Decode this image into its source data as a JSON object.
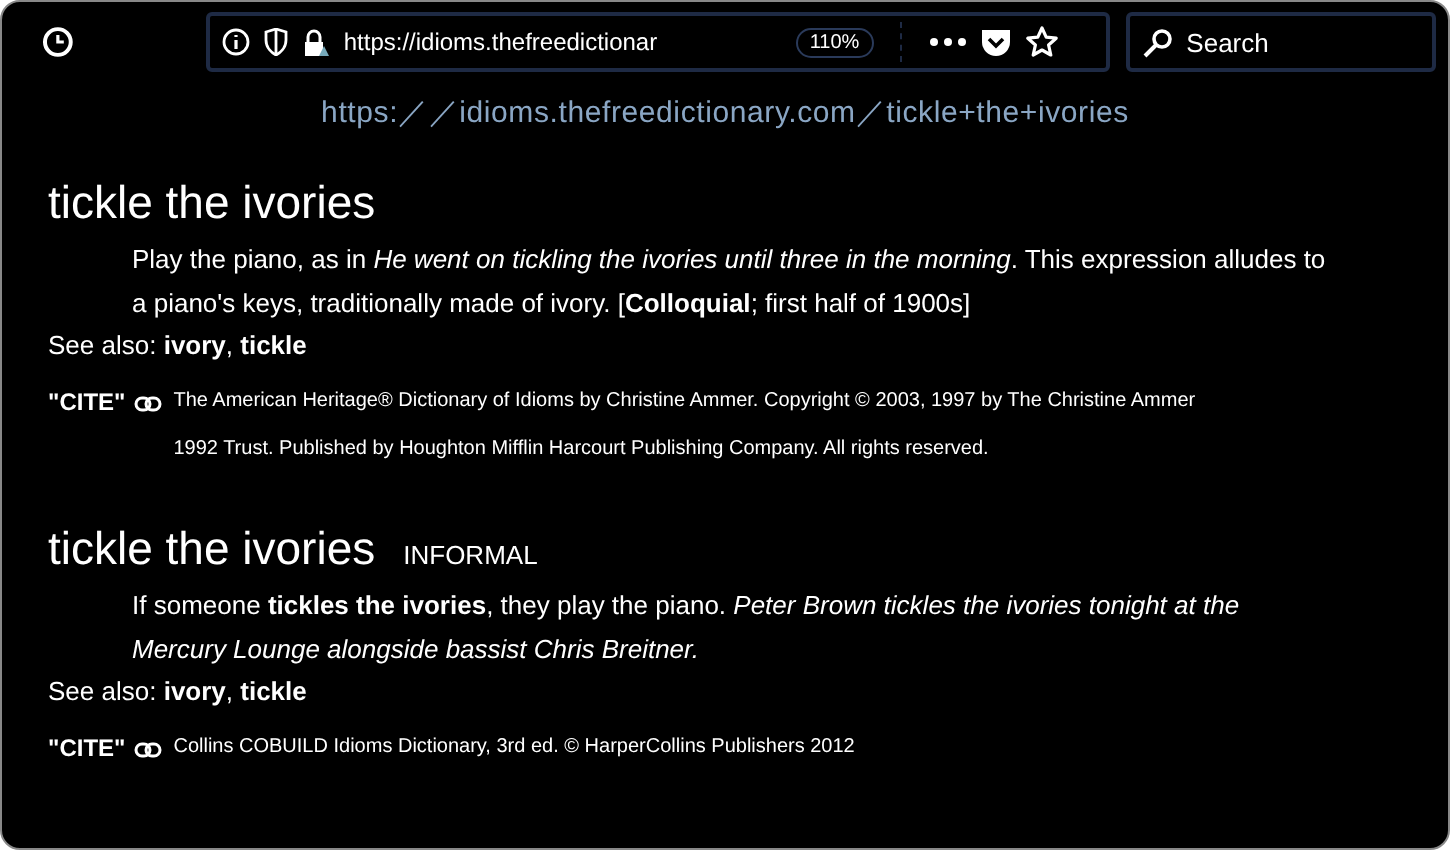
{
  "toolbar": {
    "url": "https://idioms.thefreedictionar",
    "zoom": "110%",
    "search_placeholder": "Search"
  },
  "caption": "https:／／idioms.thefreedictionary.com／tickle+the+ivories",
  "entries": [
    {
      "headword": "tickle the ivories",
      "definition": "Play the piano, as in *He went on tickling the ivories until three in the morning*. This expression alludes to a piano's keys, traditionally made of ivory. [**Colloquial**; first half of 1900s]",
      "see_also": "See also: **ivory**, **tickle**",
      "cite": "\"CITE\"",
      "source": "The American Heritage® Dictionary of Idioms by Christine Ammer. Copyright © 2003, 1997 by The Christine Ammer 1992 Trust. Published by Houghton Mifflin Harcourt Publishing Company. All rights reserved."
    },
    {
      "headword": "tickle the ivories",
      "label": "INFORMAL",
      "definition": "If someone **tickles the ivories**, they play the piano. *Peter Brown tickles the ivories tonight at the Mercury Lounge alongside bassist Chris Breitner.*",
      "see_also": "See also: **ivory**, **tickle**",
      "cite": "\"CITE\"",
      "source": "Collins COBUILD Idioms Dictionary, 3rd ed. © HarperCollins Publishers 2012"
    }
  ]
}
